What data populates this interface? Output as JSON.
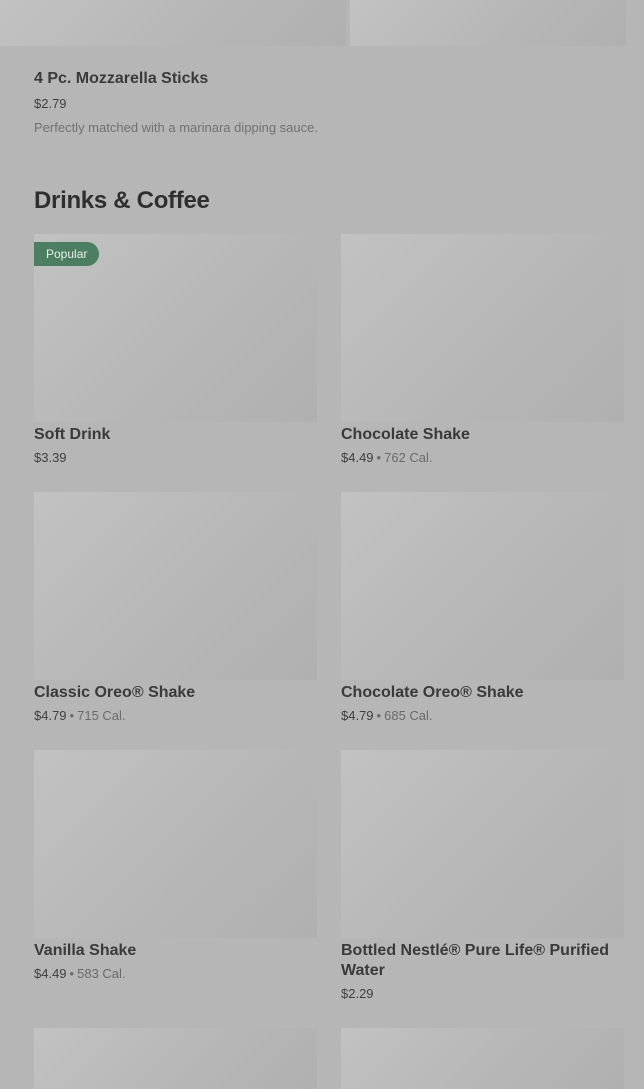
{
  "top_item": {
    "name": "4 Pc. Mozzarella Sticks",
    "price": "$2.79",
    "description": "Perfectly matched with a marinara dipping sauce."
  },
  "section": {
    "title": "Drinks & Coffee"
  },
  "badge": "Popular",
  "separator": "•",
  "items": [
    {
      "name": "Soft Drink",
      "price": "$3.39",
      "calories": ""
    },
    {
      "name": "Chocolate Shake",
      "price": "$4.49",
      "calories": "762 Cal."
    },
    {
      "name": "Classic Oreo® Shake",
      "price": "$4.79",
      "calories": "715 Cal."
    },
    {
      "name": "Chocolate Oreo® Shake",
      "price": "$4.79",
      "calories": "685 Cal."
    },
    {
      "name": "Vanilla Shake",
      "price": "$4.49",
      "calories": "583 Cal."
    },
    {
      "name": "Bottled Nestlé® Pure Life® Purified Water",
      "price": "$2.29",
      "calories": ""
    }
  ]
}
